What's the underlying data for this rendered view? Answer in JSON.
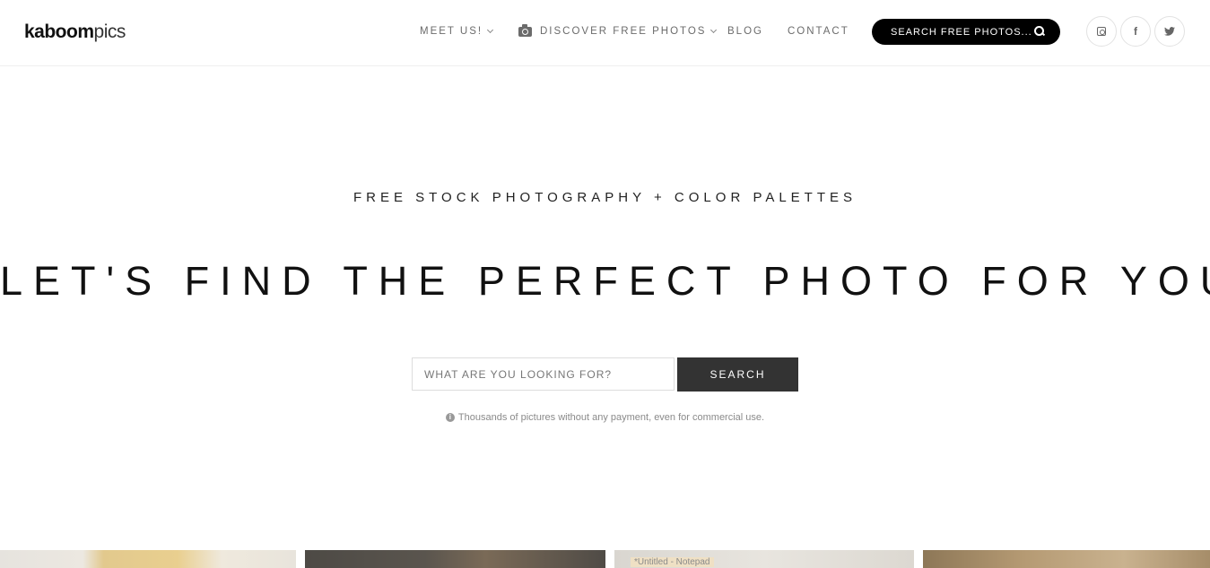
{
  "header": {
    "logo_bold": "kaboom",
    "logo_light": "pics",
    "nav": {
      "meet_us": "MEET US!",
      "discover": "DISCOVER FREE PHOTOS",
      "blog": "BLOG",
      "contact": "CONTACT"
    },
    "search_pill_label": "SEARCH FREE PHOTOS...",
    "social": [
      "instagram-icon",
      "facebook-icon",
      "twitter-icon"
    ],
    "facebook_glyph": "f"
  },
  "hero": {
    "tagline": "FREE STOCK PHOTOGRAPHY + COLOR PALETTES",
    "headline": "LET'S FIND THE PERFECT PHOTO FOR YOU",
    "search_placeholder": "WHAT ARE YOU LOOKING FOR?",
    "search_button": "SEARCH",
    "note": "Thousands of pictures without any payment, even for commercial use."
  },
  "photos": {
    "thumb3_overlay_text": "*Untitled - Notepad"
  },
  "colors": {
    "accent_black": "#000000",
    "button_dark": "#333333",
    "nav_text": "#6b6b6b"
  }
}
